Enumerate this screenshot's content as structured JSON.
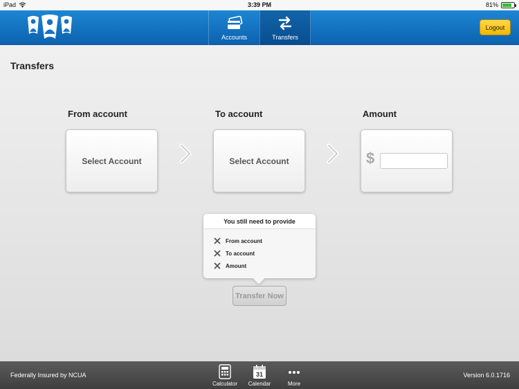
{
  "status_bar": {
    "device": "iPad",
    "time": "3:39 PM",
    "battery": "81%",
    "battery_level": 0.81
  },
  "navbar": {
    "tabs": [
      {
        "label": "Accounts",
        "icon": "cards-icon"
      },
      {
        "label": "Transfers",
        "icon": "transfer-arrows-icon"
      }
    ],
    "active_tab": "Transfers",
    "logout_label": "Logout"
  },
  "main": {
    "title": "Transfers",
    "from": {
      "label": "From account",
      "button": "Select Account"
    },
    "to": {
      "label": "To account",
      "button": "Select Account"
    },
    "amount": {
      "label": "Amount",
      "currency": "$",
      "value": ""
    },
    "requirements": {
      "title": "You still need to provide",
      "items": [
        "From account",
        "To account",
        "Amount"
      ]
    },
    "submit_label": "Transfer Now"
  },
  "footer": {
    "insured_text": "Federally Insured by NCUA",
    "tools": [
      {
        "label": "Calculator",
        "icon": "calculator-icon"
      },
      {
        "label": "Calendar",
        "icon": "calendar-icon",
        "day": "31"
      },
      {
        "label": "More",
        "icon": "more-dots-icon"
      }
    ],
    "version": "Version 6.0.1716"
  },
  "colors": {
    "navbar": "#1572c4",
    "logout": "#f5c518",
    "footer": "#4a4a4a",
    "battery_fill": "#2ec52e"
  }
}
